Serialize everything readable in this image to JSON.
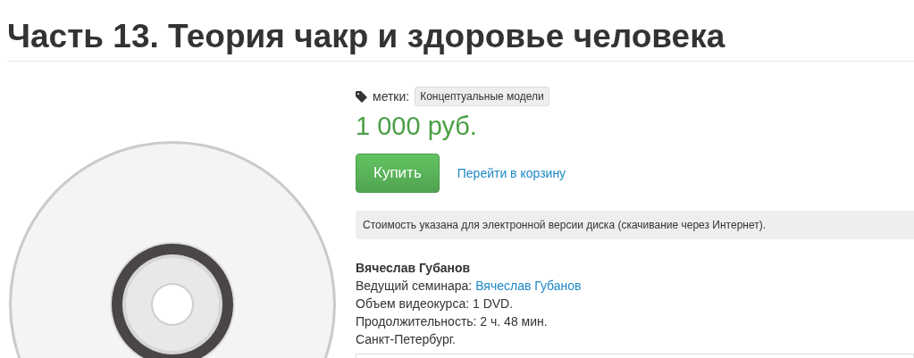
{
  "title": "Часть 13. Теория чакр и здоровье человека",
  "tags": {
    "label": "метки:",
    "items": [
      "Концептуальные модели"
    ]
  },
  "price": "1 000 руб.",
  "buy_button": "Купить",
  "cart_link": "Перейти в корзину",
  "notice": "Стоимость указана для электронной версии диска (скачивание через Интернет).",
  "details": {
    "author": "Вячеслав Губанов",
    "lines": [
      {
        "label": "Ведущий семинара: ",
        "link": "Вячеслав Губанов"
      },
      {
        "label": "Объем видеокурса: 1 DVD."
      },
      {
        "label": "Продолжительность: 2 ч. 48 мин."
      },
      {
        "label": "Санкт-Петербург."
      }
    ]
  }
}
